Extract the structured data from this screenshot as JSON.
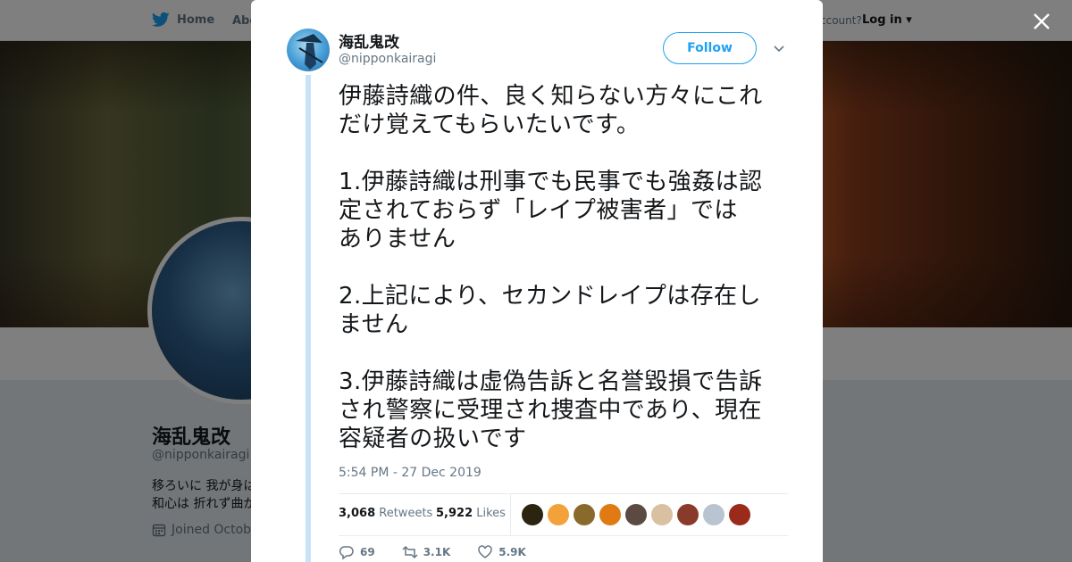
{
  "nav": {
    "home_label": "Home",
    "about_label": "Abo",
    "account_text": "ccount?",
    "login_label": "Log in"
  },
  "profile": {
    "name": "海乱鬼改",
    "handle": "@nipponkairagi",
    "bio_line1": "移ろいに 我が身は",
    "bio_line2": "和心は 折れず曲が",
    "joined": "Joined Octobe"
  },
  "tweet": {
    "author_name": "海乱鬼改",
    "author_handle": "@nipponkairagi",
    "follow_label": "Follow",
    "text_lines": [
      "伊藤詩織の件、良く知らない方々にこれ",
      "だけ覚えてもらいたいです。",
      "",
      "1.伊藤詩織は刑事でも民事でも強姦は認",
      "定されておらず「レイプ被害者」では",
      "ありません",
      "",
      "2.上記により、セカンドレイプは存在し",
      "ません",
      "",
      "3.伊藤詩織は虚偽告訴と名誉毀損で告訴",
      "され警察に受理され捜査中であり、現在",
      "容疑者の扱いです"
    ],
    "timestamp": "5:54 PM - 27 Dec 2019",
    "retweets_count": "3,068",
    "retweets_label": "Retweets",
    "likes_count": "5,922",
    "likes_label": "Likes",
    "reply_count": "69",
    "retweet_action_count": "3.1K",
    "like_action_count": "5.9K"
  },
  "liker_colors": [
    "#2b2410",
    "#f3a13a",
    "#8a6a2c",
    "#e07a12",
    "#5a4a42",
    "#d8c0a0",
    "#8a3a2a",
    "#b8c4d0",
    "#9a2a1a"
  ],
  "colors": {
    "accent": "#1da1f2",
    "text": "#14171a",
    "muted": "#657786"
  }
}
